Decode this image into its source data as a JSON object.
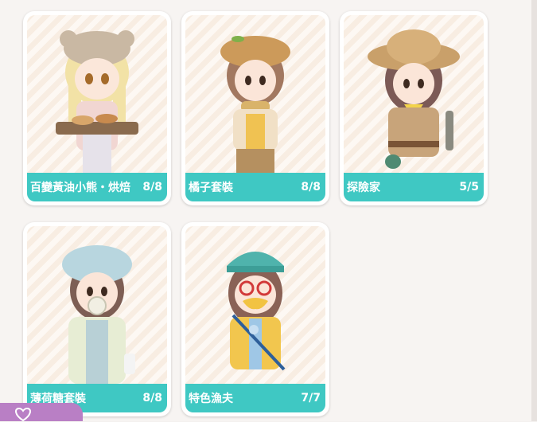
{
  "outfits": [
    {
      "name": "百變黃油小熊・烘焙",
      "count": "8/8",
      "icon": "bear-baker-figure"
    },
    {
      "name": "橘子套裝",
      "count": "8/8",
      "icon": "orange-outfit-figure"
    },
    {
      "name": "探險家",
      "count": "5/5",
      "icon": "explorer-figure"
    },
    {
      "name": "薄荷糖套裝",
      "count": "8/8",
      "icon": "mint-candy-figure"
    },
    {
      "name": "特色漁夫",
      "count": "7/7",
      "icon": "fisherman-figure"
    }
  ],
  "colors": {
    "label_bar": "#3fc8c3",
    "card_bg": "#f8ede2",
    "badge": "#b97fc5"
  }
}
